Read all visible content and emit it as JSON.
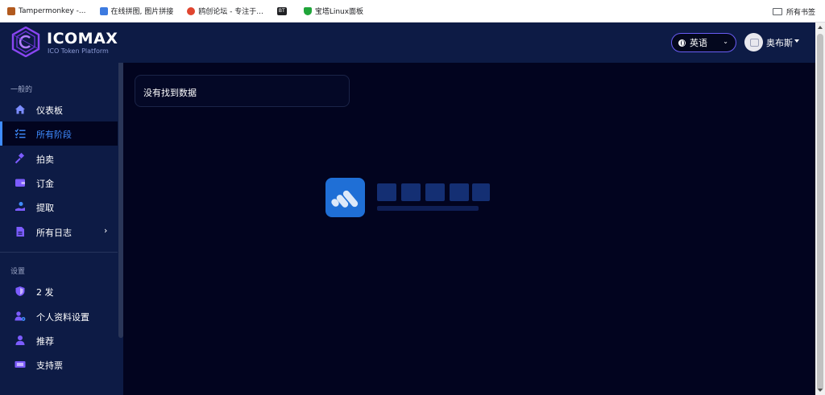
{
  "bookmarks": [
    {
      "label": "Tampermonkey -...",
      "color": "#b25a1e"
    },
    {
      "label": "在线拼图, 图片拼接",
      "color": "#3d7be0"
    },
    {
      "label": "鸥创论坛 - 专注于...",
      "color": "#e0452f"
    },
    {
      "label": "",
      "badge": "BT",
      "color": "#202124"
    },
    {
      "label": "宝塔Linux面板",
      "color": "#20a53a"
    }
  ],
  "bookmarks_folder": "所有书签",
  "brand": {
    "name": "ICOMAX",
    "tagline": "ICO Token Platform",
    "accent": "#7a3cf0"
  },
  "header": {
    "language": "英语",
    "user_name": "奥布斯"
  },
  "sidebar": {
    "sections": [
      {
        "label": "一般的",
        "items": [
          {
            "label": "仪表板",
            "icon": "home-icon",
            "active": false
          },
          {
            "label": "所有阶段",
            "icon": "list-check-icon",
            "active": true
          },
          {
            "label": "拍卖",
            "icon": "gavel-icon",
            "active": false
          },
          {
            "label": "订金",
            "icon": "wallet-icon",
            "active": false
          },
          {
            "label": "提取",
            "icon": "hand-money-icon",
            "active": false
          },
          {
            "label": "所有日志",
            "icon": "file-icon",
            "active": false,
            "has_submenu": true
          }
        ]
      },
      {
        "label": "设置",
        "items": [
          {
            "label": "2 发",
            "icon": "shield-icon",
            "active": false
          },
          {
            "label": "个人资料设置",
            "icon": "user-gear-icon",
            "active": false
          },
          {
            "label": "推荐",
            "icon": "user-icon",
            "active": false
          },
          {
            "label": "支持票",
            "icon": "ticket-icon",
            "active": false
          }
        ]
      }
    ]
  },
  "main": {
    "empty_message": "没有找到数据"
  },
  "colors": {
    "page_bg": "#02041f",
    "panel_bg": "#0d1b45",
    "active": "#3f8cff",
    "icon_accent": "#7c5cff"
  }
}
